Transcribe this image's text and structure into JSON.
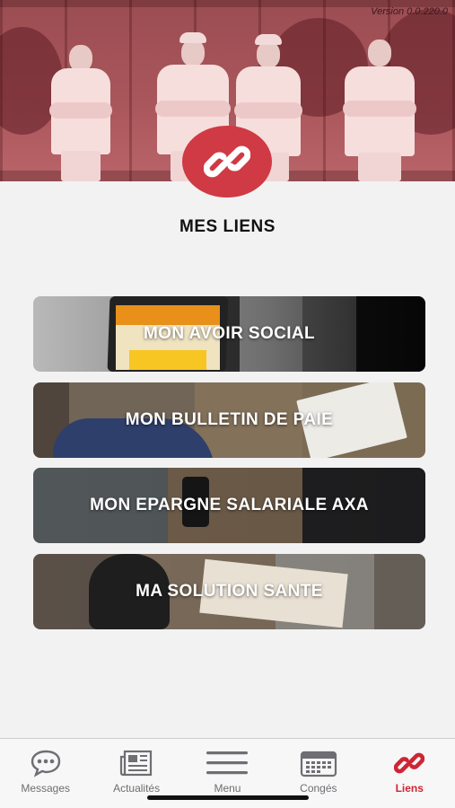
{
  "header": {
    "version": "Version 0.0.220.0",
    "badge_icon": "link-icon",
    "accent_color": "#cf3a44"
  },
  "page": {
    "title": "MES LIENS"
  },
  "links": [
    {
      "label": "MON AVOIR SOCIAL"
    },
    {
      "label": "MON BULLETIN DE PAIE"
    },
    {
      "label": "MON EPARGNE SALARIALE AXA"
    },
    {
      "label": "MA SOLUTION SANTE"
    }
  ],
  "tabbar": {
    "active_color": "#cf2534",
    "items": [
      {
        "label": "Messages",
        "icon": "chat-bubble-icon"
      },
      {
        "label": "Actualités",
        "icon": "newspaper-icon"
      },
      {
        "label": "Menu",
        "icon": "hamburger-menu-icon"
      },
      {
        "label": "Congés",
        "icon": "calendar-icon"
      },
      {
        "label": "Liens",
        "icon": "link-icon"
      }
    ]
  }
}
